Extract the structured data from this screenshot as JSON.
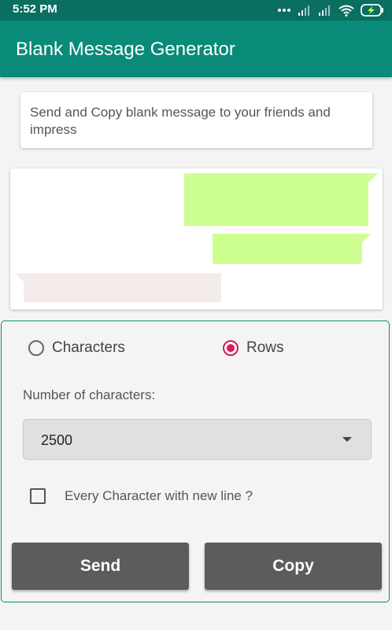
{
  "status_bar": {
    "time": "5:52 PM",
    "icons": [
      "more-dots-icon",
      "signal-icon",
      "signal-icon",
      "wifi-icon",
      "battery-charging-icon"
    ]
  },
  "app_bar": {
    "title": "Blank Message Generator"
  },
  "description": {
    "text": "Send and Copy blank message to your friends and impress"
  },
  "options": {
    "mode": {
      "options": [
        {
          "label": "Characters",
          "selected": false
        },
        {
          "label": "Rows",
          "selected": true
        }
      ]
    },
    "number_label": "Number of characters:",
    "dropdown_value": "2500",
    "newline_checkbox": {
      "label": "Every Character with new line ?",
      "checked": false
    }
  },
  "buttons": {
    "send_label": "Send",
    "copy_label": "Copy"
  },
  "colors": {
    "app_bar": "#0a8a78",
    "status_bar": "#0a6e60",
    "outgoing_bubble": "#ccff90",
    "incoming_bubble": "#f4ebeb",
    "radio_accent": "#d81b60",
    "button": "#5c5c5c"
  }
}
